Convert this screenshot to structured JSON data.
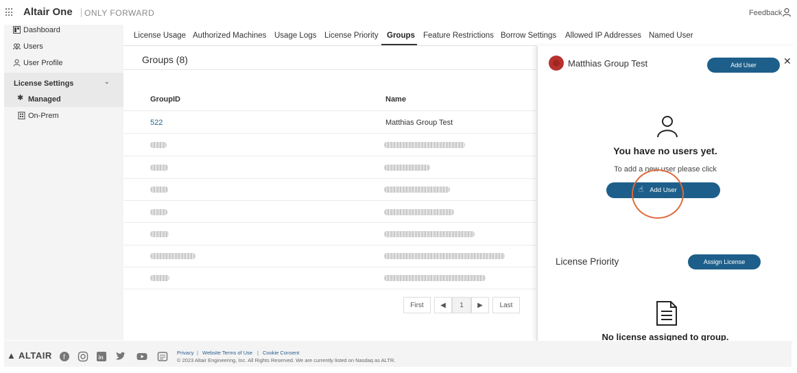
{
  "header": {
    "brand": "Altair One",
    "tagline": "ONLY FORWARD",
    "feedback": "Feedback"
  },
  "sidebar": {
    "items": [
      {
        "label": "Dashboard",
        "icon": "dashboard-icon"
      },
      {
        "label": "Users",
        "icon": "users-icon"
      },
      {
        "label": "User Profile",
        "icon": "user-icon"
      }
    ],
    "section": "License Settings",
    "sub_items": [
      {
        "label": "Managed",
        "icon": "gear-icon",
        "active": true
      },
      {
        "label": "On-Prem",
        "icon": "building-icon",
        "active": false
      }
    ]
  },
  "tabs": [
    "License Usage",
    "Authorized Machines",
    "Usage Logs",
    "License Priority",
    "Groups",
    "Feature Restrictions",
    "Borrow Settings",
    "Allowed IP Addresses",
    "Named User"
  ],
  "active_tab": "Groups",
  "groups": {
    "title": "Groups (8)",
    "columns": [
      "GroupID",
      "Name"
    ],
    "first_row": {
      "id": "522",
      "name": "Matthias Group Test"
    },
    "blurred_rows": 7
  },
  "pagination": {
    "first": "First",
    "page": "1",
    "last": "Last"
  },
  "panel": {
    "group_name": "Matthias Group Test",
    "add_user_top": "Add User",
    "empty_title": "You have no users yet.",
    "empty_sub": "To add a new user please click",
    "add_user_center": "Add User",
    "license_priority": "License Priority",
    "assign_license": "Assign License",
    "no_license": "No license assigned to group."
  },
  "footer": {
    "logo": "ALTAIR",
    "links": [
      "Privacy",
      "Website Terms of Use",
      "Cookie Consent"
    ],
    "copyright": "© 2023 Altair Engineering, Inc. All Rights Reserved. We are currently listed on Nasdaq as ALTR."
  },
  "colors": {
    "accent": "#1d5f8a",
    "avatar": "#b7322f",
    "highlight_circle": "#e0693a"
  }
}
